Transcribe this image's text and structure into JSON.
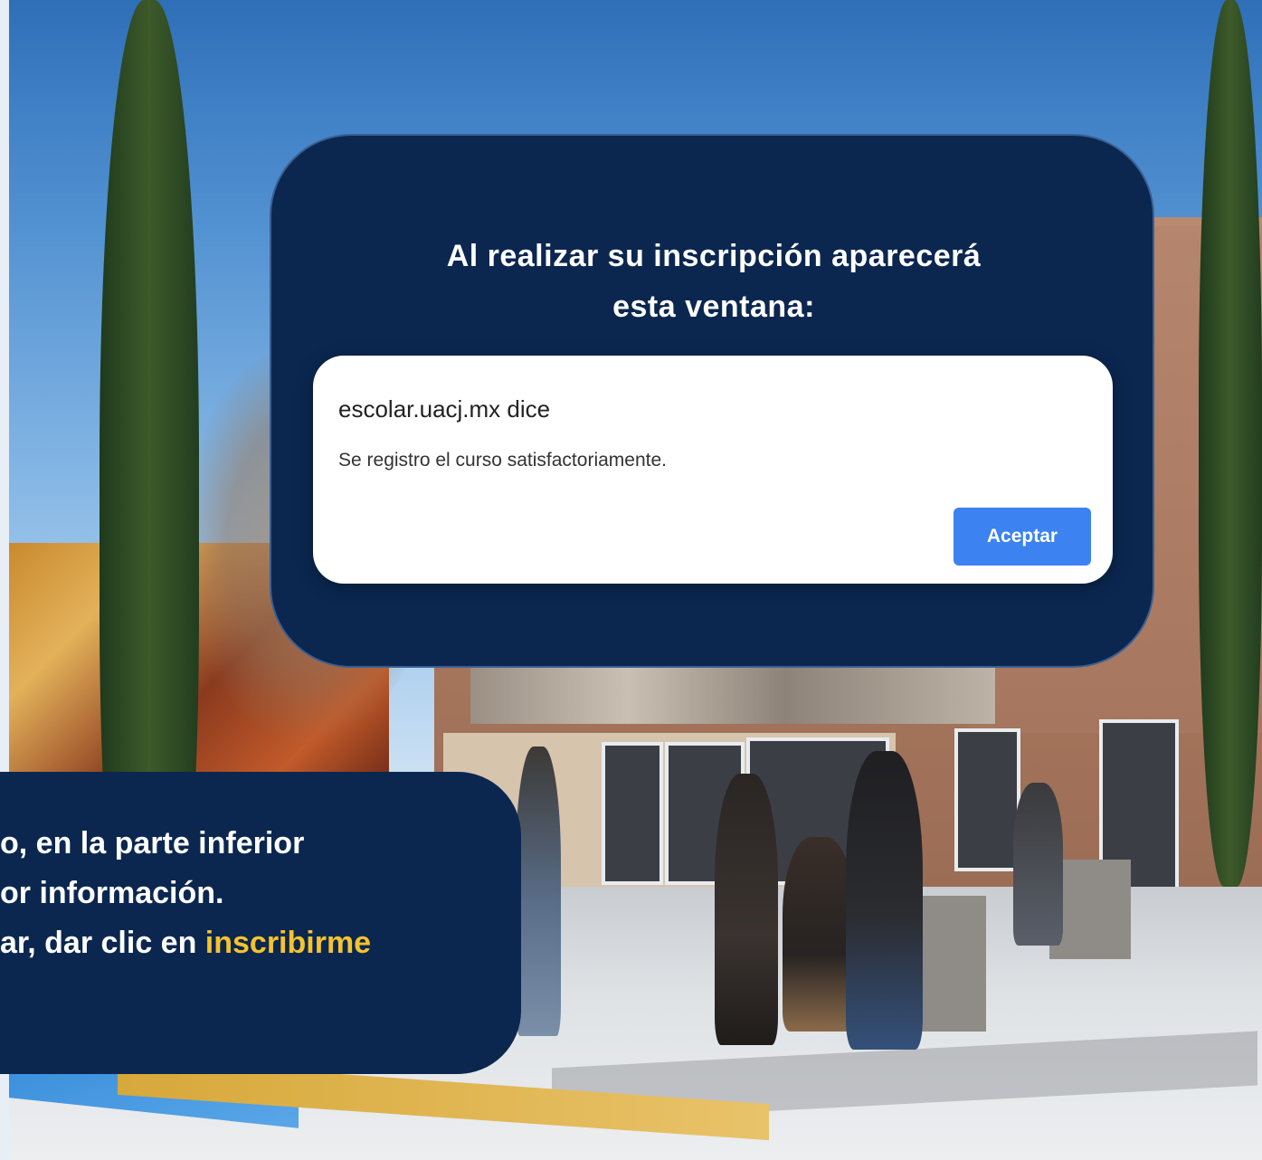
{
  "background": {
    "description_icon": "campus-photo"
  },
  "top_card": {
    "title_line1": "Al realizar su inscripción aparecerá",
    "title_line2": "esta ventana:"
  },
  "dialog": {
    "origin": "escolar.uacj.mx dice",
    "message": "Se registro el curso satisfactoriamente.",
    "accept_label": "Aceptar"
  },
  "bottom_card": {
    "line1": "o, en la parte inferior",
    "line2": "or información.",
    "line3_prefix": "ar, dar clic en ",
    "line3_highlight": "inscribirme"
  },
  "colors": {
    "card_bg": "#0b2750",
    "accent_yellow": "#f5c32c",
    "button_blue": "#3c82f0"
  }
}
